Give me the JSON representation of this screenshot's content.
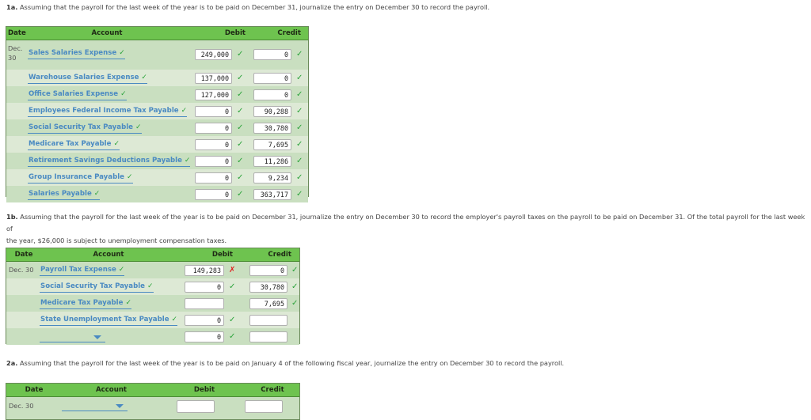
{
  "q1a": {
    "num": "1a.",
    "text": "Assuming that the payroll for the last week of the year is to be paid on December 31, journalize the entry on December 30 to record the payroll."
  },
  "q1b": {
    "num": "1b.",
    "text": "Assuming that the payroll for the last week of the year is to be paid on December 31, journalize the entry on December 30 to record the employer's payroll taxes on the payroll to be paid on December 31. Of the total payroll for the last week of",
    "text2": "the year, $26,000 is subject to unemployment compensation taxes."
  },
  "q2a": {
    "num": "2a.",
    "text": "Assuming that the payroll for the last week of the year is to be paid on January 4 of the following fiscal year, journalize the entry on December 30 to record the payroll."
  },
  "headers": {
    "date": "Date",
    "account": "Account",
    "debit": "Debit",
    "credit": "Credit"
  },
  "check_mark": "✓",
  "x_mark": "✗",
  "t1": {
    "date_line1": "Dec.",
    "date_line2": "30",
    "rows": [
      {
        "account": "Sales Salaries Expense",
        "debit": "249,000",
        "debit_mark": "✓",
        "credit": "0",
        "credit_mark": "✓"
      },
      {
        "account": "Warehouse Salaries Expense",
        "debit": "137,000",
        "debit_mark": "✓",
        "credit": "0",
        "credit_mark": "✓"
      },
      {
        "account": "Office Salaries Expense",
        "debit": "127,000",
        "debit_mark": "✓",
        "credit": "0",
        "credit_mark": "✓"
      },
      {
        "account": "Employees Federal Income Tax Payable",
        "debit": "0",
        "debit_mark": "✓",
        "credit": "90,288",
        "credit_mark": "✓"
      },
      {
        "account": "Social Security Tax Payable",
        "debit": "0",
        "debit_mark": "✓",
        "credit": "30,780",
        "credit_mark": "✓"
      },
      {
        "account": "Medicare Tax Payable",
        "debit": "0",
        "debit_mark": "✓",
        "credit": "7,695",
        "credit_mark": "✓"
      },
      {
        "account": "Retirement Savings Deductions Payable",
        "debit": "0",
        "debit_mark": "✓",
        "credit": "11,286",
        "credit_mark": "✓"
      },
      {
        "account": "Group Insurance Payable",
        "debit": "0",
        "debit_mark": "✓",
        "credit": "9,234",
        "credit_mark": "✓"
      },
      {
        "account": "Salaries Payable",
        "debit": "0",
        "debit_mark": "✓",
        "credit": "363,717",
        "credit_mark": "✓"
      }
    ]
  },
  "t2": {
    "date": "Dec. 30",
    "rows": [
      {
        "account": "Payroll Tax Expense",
        "debit": "149,283",
        "debit_mark": "✗",
        "credit": "0",
        "credit_mark": "✓"
      },
      {
        "account": "Social Security Tax Payable",
        "debit": "0",
        "debit_mark": "✓",
        "credit": "30,780",
        "credit_mark": "✓"
      },
      {
        "account": "Medicare Tax Payable",
        "debit": "",
        "debit_mark": "",
        "credit": "7,695",
        "credit_mark": "✓"
      },
      {
        "account": "State Unemployment Tax Payable",
        "debit": "0",
        "debit_mark": "✓",
        "credit": "",
        "credit_mark": ""
      },
      {
        "account": "",
        "debit": "0",
        "debit_mark": "✓",
        "credit": "",
        "credit_mark": ""
      }
    ]
  },
  "t3": {
    "date": "Dec. 30",
    "rows": [
      {
        "account": "",
        "debit": "",
        "credit": ""
      }
    ]
  }
}
